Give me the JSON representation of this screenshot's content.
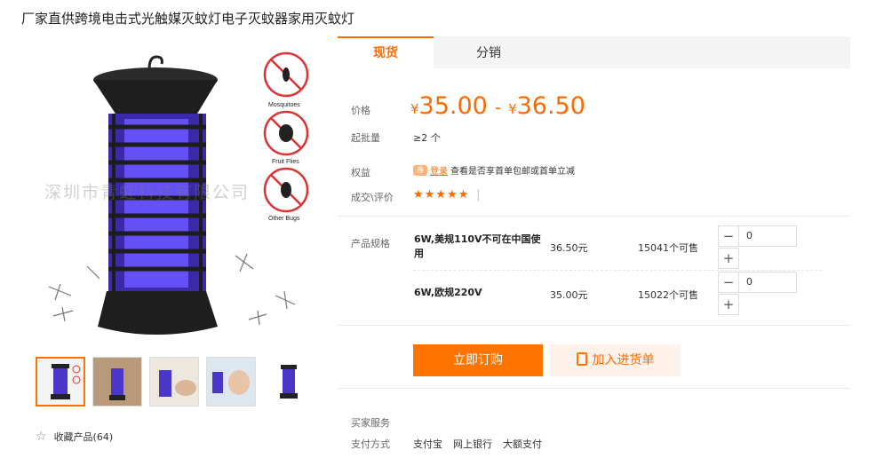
{
  "product": {
    "title": "厂家直供跨境电击式光触媒灭蚊灯电子灭蚊器家用灭蚊灯",
    "watermark": "深圳市青蛙科技有限公司",
    "main_image_labels": [
      "Mosquitoes",
      "Fruit Flies",
      "Other Bugs"
    ],
    "favorite_label": "收藏产品(64)"
  },
  "tabs": [
    {
      "label": "现货",
      "active": true
    },
    {
      "label": "分销",
      "active": false
    }
  ],
  "pricing": {
    "price_label": "价格",
    "currency": "¥",
    "price_low": "35.00",
    "price_high": "36.50",
    "separator": "-",
    "moq_label": "起批量",
    "moq_value": "≥2 个"
  },
  "benefits": {
    "label": "权益",
    "badge": "券",
    "link": "登录",
    "text": "查看是否享首单包邮或首单立减"
  },
  "reviews": {
    "label": "成交\\评价",
    "stars": "★★★★★",
    "divider": "|"
  },
  "specs": {
    "label": "产品规格",
    "items": [
      {
        "name": "6W,美规110V不可在中国使用",
        "price": "36.50元",
        "stock": "15041个可售",
        "qty": "0"
      },
      {
        "name": "6W,欧规220V",
        "price": "35.00元",
        "stock": "15022个可售",
        "qty": "0"
      }
    ],
    "minus": "−",
    "plus": "+"
  },
  "actions": {
    "buy_now": "立即订购",
    "add_cart": "加入进货单"
  },
  "service": {
    "buyer_service_label": "买家服务",
    "payment_label": "支付方式",
    "payment_methods": [
      "支付宝",
      "网上银行",
      "大额支付"
    ]
  },
  "colors": {
    "accent": "#ff6a00",
    "button": "#ff7300",
    "cart_bg": "#fff2ea"
  }
}
